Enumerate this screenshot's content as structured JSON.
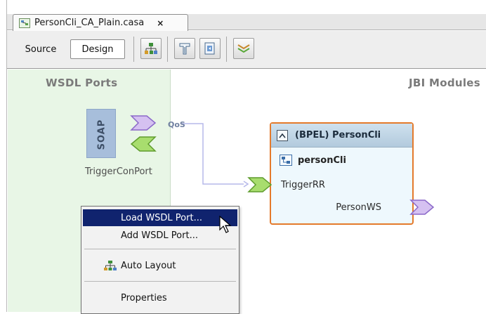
{
  "tab": {
    "title": "PersonCli_CA_Plain.casa",
    "close_glyph": "×"
  },
  "toolbar": {
    "source_label": "Source",
    "design_label": "Design",
    "icons": [
      "auto-layout-icon",
      "build-icon",
      "deploy-icon",
      "validate-icon"
    ]
  },
  "regions": {
    "wsdl_title": "WSDL Ports",
    "jbi_title": "JBI Modules"
  },
  "soap_port": {
    "binding_label": "SOAP",
    "qos_label": "QoS",
    "name": "TriggerConPort"
  },
  "bpel_module": {
    "title": "(BPEL) PersonCli",
    "unit_name": "personCli",
    "consumer_endpoint": "TriggerRR",
    "provider_endpoint": "PersonWS",
    "border_color": "#e47a2b"
  },
  "context_menu": {
    "items": [
      {
        "label": "Load WSDL Port...",
        "selected": true
      },
      {
        "label": "Add WSDL Port...",
        "selected": false
      },
      {
        "label": "Auto Layout",
        "selected": false
      },
      {
        "label": "Properties",
        "selected": false
      }
    ],
    "highlight_color": "#10236e"
  },
  "colors": {
    "wsdl_region_bg": "#e8f6e6",
    "soap_box": "#a7bedb"
  }
}
